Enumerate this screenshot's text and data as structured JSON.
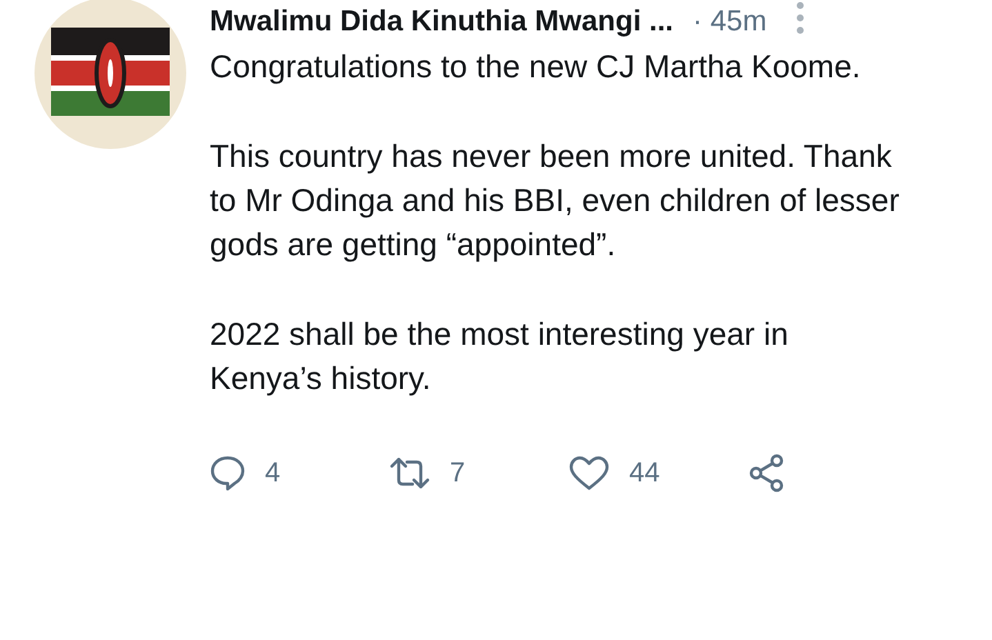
{
  "tweet": {
    "author": "Mwalimu Dida Kinuthia Mwangi ...",
    "time": "· 45m",
    "paragraphs": [
      "Congratulations to the new CJ Martha Koome.",
      "This country has never been more united. Thank to Mr Odinga and his BBI, even children of lesser gods are getting “appointed”.",
      "2022 shall be the most interesting year in Kenya’s history."
    ],
    "actions": [
      {
        "kind": "reply",
        "count": "4"
      },
      {
        "kind": "retweet",
        "count": "7"
      },
      {
        "kind": "like",
        "count": "44"
      },
      {
        "kind": "share"
      }
    ]
  }
}
